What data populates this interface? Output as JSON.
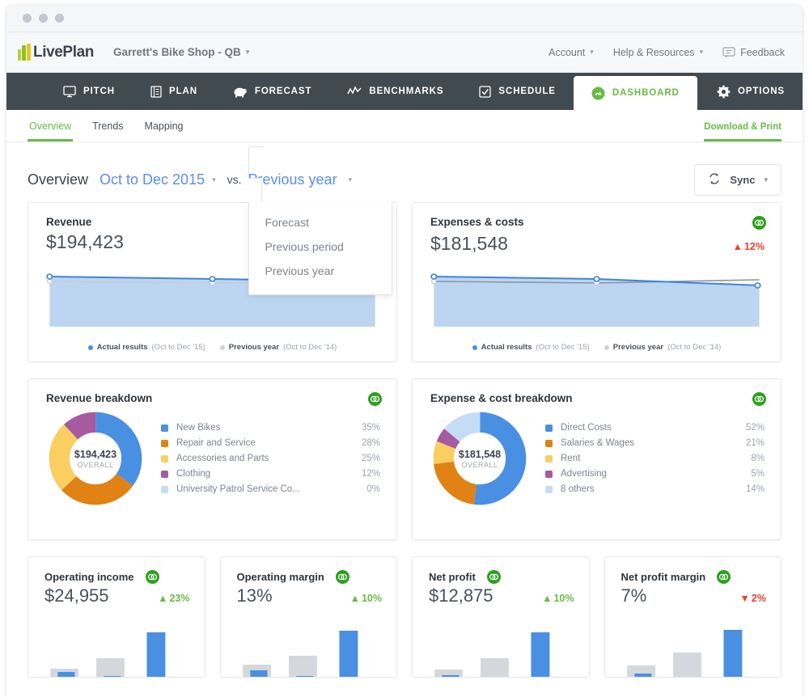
{
  "window": {
    "dots": 3
  },
  "header": {
    "logo_text": "LivePlan",
    "company": "Garrett's Bike Shop - QB",
    "account": "Account",
    "help": "Help & Resources",
    "feedback": "Feedback"
  },
  "main_nav": [
    {
      "label": "PITCH",
      "icon": "monitor-icon",
      "active": false
    },
    {
      "label": "PLAN",
      "icon": "book-icon",
      "active": false
    },
    {
      "label": "FORECAST",
      "icon": "piggy-bank-icon",
      "active": false
    },
    {
      "label": "BENCHMARKS",
      "icon": "zigzag-line-icon",
      "active": false
    },
    {
      "label": "SCHEDULE",
      "icon": "checkbox-icon",
      "active": false
    },
    {
      "label": "DASHBOARD",
      "icon": "dashboard-gauge-icon",
      "active": true
    },
    {
      "label": "OPTIONS",
      "icon": "gear-icon",
      "active": false
    }
  ],
  "sub_nav": {
    "tabs": [
      {
        "label": "Overview",
        "active": true
      },
      {
        "label": "Trends",
        "active": false
      },
      {
        "label": "Mapping",
        "active": false
      }
    ],
    "download_print": "Download & Print"
  },
  "overview_bar": {
    "title": "Overview",
    "period": "Oct to Dec 2015",
    "vs": "vs.",
    "compare_selected": "Previous year",
    "dropdown_options": [
      "Forecast",
      "Previous period",
      "Previous year"
    ],
    "sync_label": "Sync"
  },
  "colors": {
    "green": "#6aba45",
    "blue": "#4a90e2",
    "orange": "#e08214",
    "yellow": "#fbce62",
    "purple": "#a65aa0",
    "lightblue": "#c5dcf5",
    "red": "#e8432a",
    "quickbooks": "#2ca01c",
    "nav_dark": "#414a50"
  },
  "chart_data": [
    {
      "type": "area",
      "title": "Revenue",
      "value": "$194,423",
      "has_quickbooks_badge": false,
      "delta": null,
      "series": [
        {
          "name": "Actual results",
          "period": "(Oct to Dec '15)",
          "color": "#4a90e2",
          "values": [
            100,
            99,
            98
          ]
        },
        {
          "name": "Previous year",
          "period": "(Oct to Dec '14)",
          "color": "#c9ccd1",
          "values": [
            93,
            92,
            92
          ]
        }
      ],
      "ylim": [
        0,
        110
      ]
    },
    {
      "type": "area",
      "title": "Expenses & costs",
      "value": "$181,548",
      "has_quickbooks_badge": true,
      "delta": {
        "text": "12%",
        "direction": "up",
        "tone": "red"
      },
      "series": [
        {
          "name": "Actual results",
          "period": "(Oct to Dec '15)",
          "color": "#4a90e2",
          "values": [
            100,
            97,
            90
          ]
        },
        {
          "name": "Previous year",
          "period": "(Oct to Dec '14)",
          "color": "#c9ccd1",
          "values": [
            93,
            92,
            94
          ]
        }
      ],
      "ylim": [
        0,
        110
      ]
    },
    {
      "type": "pie",
      "title": "Revenue breakdown",
      "center_value": "$194,423",
      "center_label": "OVERALL",
      "has_quickbooks_badge": true,
      "labels": [
        "New Bikes",
        "Repair and Service",
        "Accessories and Parts",
        "Clothing",
        "University Patrol Service Co..."
      ],
      "values": [
        35,
        28,
        25,
        12,
        0
      ],
      "display_pcts": [
        "35%",
        "28%",
        "25%",
        "12%",
        "0%"
      ],
      "colors": [
        "#4a90e2",
        "#e08214",
        "#fbce62",
        "#a65aa0",
        "#c5dcf5"
      ]
    },
    {
      "type": "pie",
      "title": "Expense & cost breakdown",
      "center_value": "$181,548",
      "center_label": "OVERALL",
      "has_quickbooks_badge": true,
      "labels": [
        "Direct Costs",
        "Salaries & Wages",
        "Rent",
        "Advertising",
        "8 others"
      ],
      "values": [
        52,
        21,
        8,
        5,
        14
      ],
      "display_pcts": [
        "52%",
        "21%",
        "8%",
        "5%",
        "14%"
      ],
      "colors": [
        "#4a90e2",
        "#e08214",
        "#fbce62",
        "#a65aa0",
        "#c5dcf5"
      ]
    },
    {
      "type": "bar",
      "title": "Operating income",
      "value": "$24,955",
      "has_quickbooks_badge": true,
      "delta": {
        "text": "23%",
        "direction": "up",
        "tone": "green"
      },
      "categories": [
        "1",
        "2",
        "3"
      ],
      "series": [
        {
          "name": "Previous year",
          "color": "#d4d7dc",
          "values": [
            16,
            34,
            0
          ]
        },
        {
          "name": "Actual results",
          "color": "#4a90e2",
          "values": [
            9,
            2,
            80
          ]
        }
      ],
      "ylim": [
        0,
        100
      ]
    },
    {
      "type": "bar",
      "title": "Operating margin",
      "value": "13%",
      "has_quickbooks_badge": true,
      "delta": {
        "text": "10%",
        "direction": "up",
        "tone": "green"
      },
      "categories": [
        "1",
        "2",
        "3"
      ],
      "series": [
        {
          "name": "Previous year",
          "color": "#d4d7dc",
          "values": [
            24,
            38,
            0
          ]
        },
        {
          "name": "Actual results",
          "color": "#4a90e2",
          "values": [
            14,
            3,
            82
          ]
        }
      ],
      "ylim": [
        0,
        100
      ]
    },
    {
      "type": "bar",
      "title": "Net profit",
      "value": "$12,875",
      "has_quickbooks_badge": true,
      "delta": {
        "text": "10%",
        "direction": "up",
        "tone": "green"
      },
      "categories": [
        "1",
        "2",
        "3"
      ],
      "series": [
        {
          "name": "Previous year",
          "color": "#d4d7dc",
          "values": [
            14,
            35,
            0
          ]
        },
        {
          "name": "Actual results",
          "color": "#4a90e2",
          "values": [
            6,
            2,
            80
          ]
        }
      ],
      "ylim": [
        0,
        100
      ]
    },
    {
      "type": "bar",
      "title": "Net profit margin",
      "value": "7%",
      "has_quickbooks_badge": true,
      "delta": {
        "text": "2%",
        "direction": "down",
        "tone": "red"
      },
      "categories": [
        "1",
        "2",
        "3"
      ],
      "series": [
        {
          "name": "Previous year",
          "color": "#d4d7dc",
          "values": [
            22,
            45,
            0
          ]
        },
        {
          "name": "Actual results",
          "color": "#4a90e2",
          "values": [
            8,
            3,
            84
          ]
        }
      ],
      "ylim": [
        0,
        100
      ]
    }
  ]
}
